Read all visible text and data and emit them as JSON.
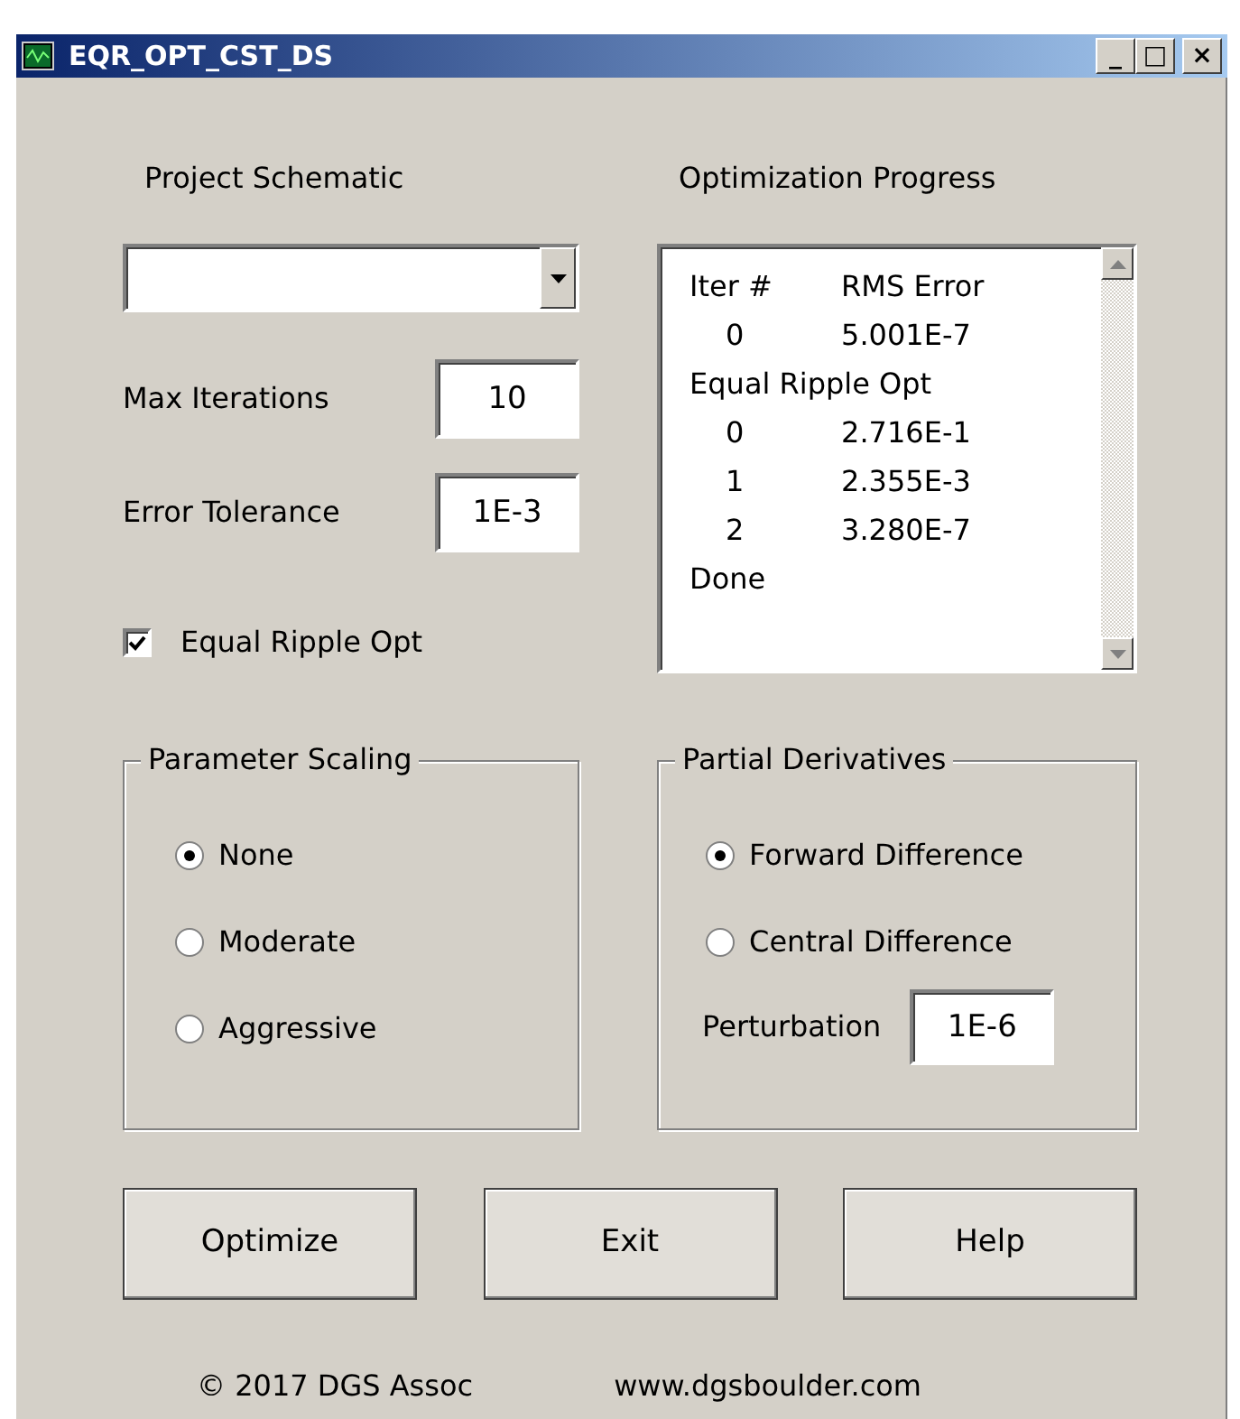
{
  "window": {
    "title": "EQR_OPT_CST_DS",
    "controls": [
      "_",
      "□",
      "×"
    ]
  },
  "project_schematic": {
    "label": "Project Schematic"
  },
  "max_iterations": {
    "label": "Max Iterations",
    "value": "10"
  },
  "error_tolerance": {
    "label": "Error Tolerance",
    "value": "1E-3"
  },
  "equal_ripple": {
    "label": "Equal Ripple Opt",
    "checked": true
  },
  "progress": {
    "label": "Optimization Progress",
    "columns": [
      "Iter #",
      "RMS Error"
    ],
    "lines": [
      {
        "kind": "row",
        "iter": "0",
        "rms": "5.001E-7"
      },
      {
        "kind": "text",
        "text": "Equal Ripple Opt"
      },
      {
        "kind": "row",
        "iter": "0",
        "rms": "2.716E-1"
      },
      {
        "kind": "row",
        "iter": "1",
        "rms": "2.355E-3"
      },
      {
        "kind": "row",
        "iter": "2",
        "rms": "3.280E-7"
      },
      {
        "kind": "text",
        "text": "Done"
      }
    ]
  },
  "parameter_scaling": {
    "title": "Parameter Scaling",
    "options": [
      {
        "label": "None",
        "selected": true
      },
      {
        "label": "Moderate",
        "selected": false
      },
      {
        "label": "Aggressive",
        "selected": false
      }
    ]
  },
  "partial_derivatives": {
    "title": "Partial Derivatives",
    "options": [
      {
        "label": "Forward Difference",
        "selected": true
      },
      {
        "label": "Central Difference",
        "selected": false
      }
    ],
    "perturbation": {
      "label": "Perturbation",
      "value": "1E-6"
    }
  },
  "buttons": [
    "Optimize",
    "Exit",
    "Help"
  ],
  "footer": {
    "copyright": "© 2017 DGS Assoc",
    "website": "www.dgsboulder.com"
  }
}
